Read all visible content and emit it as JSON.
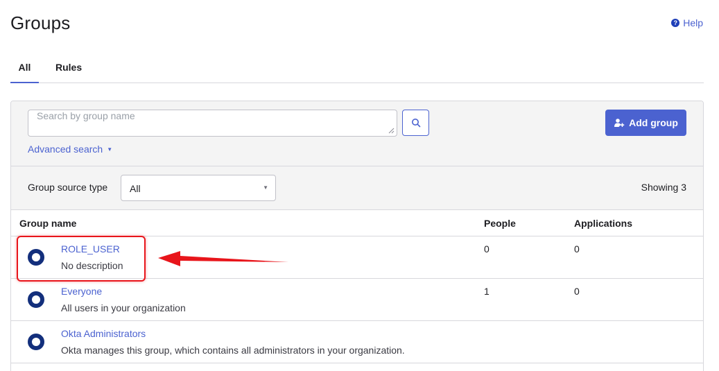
{
  "header": {
    "title": "Groups",
    "help_label": "Help",
    "help_icon": "question-circle-icon"
  },
  "tabs": [
    {
      "label": "All",
      "active": true
    },
    {
      "label": "Rules",
      "active": false
    }
  ],
  "search": {
    "placeholder": "Search by group name",
    "value": "",
    "button_icon": "search-icon",
    "advanced_label": "Advanced search"
  },
  "actions": {
    "add_group_label": "Add group",
    "add_group_icon": "add-user-icon"
  },
  "filter": {
    "label": "Group source type",
    "selected": "All"
  },
  "showing_label": "Showing 3",
  "table": {
    "columns": [
      "Group name",
      "People",
      "Applications"
    ],
    "rows": [
      {
        "name": "ROLE_USER",
        "description": "No description",
        "people": "0",
        "applications": "0"
      },
      {
        "name": "Everyone",
        "description": "All users in your organization",
        "people": "1",
        "applications": "0"
      },
      {
        "name": "Okta Administrators",
        "description": "Okta manages this group, which contains all administrators in your organization.",
        "people": "",
        "applications": ""
      }
    ]
  },
  "colors": {
    "accent": "#4b62d0",
    "group_icon": "#132f7c",
    "annotation": "#e8151b",
    "panel_bg": "#f4f4f4"
  }
}
